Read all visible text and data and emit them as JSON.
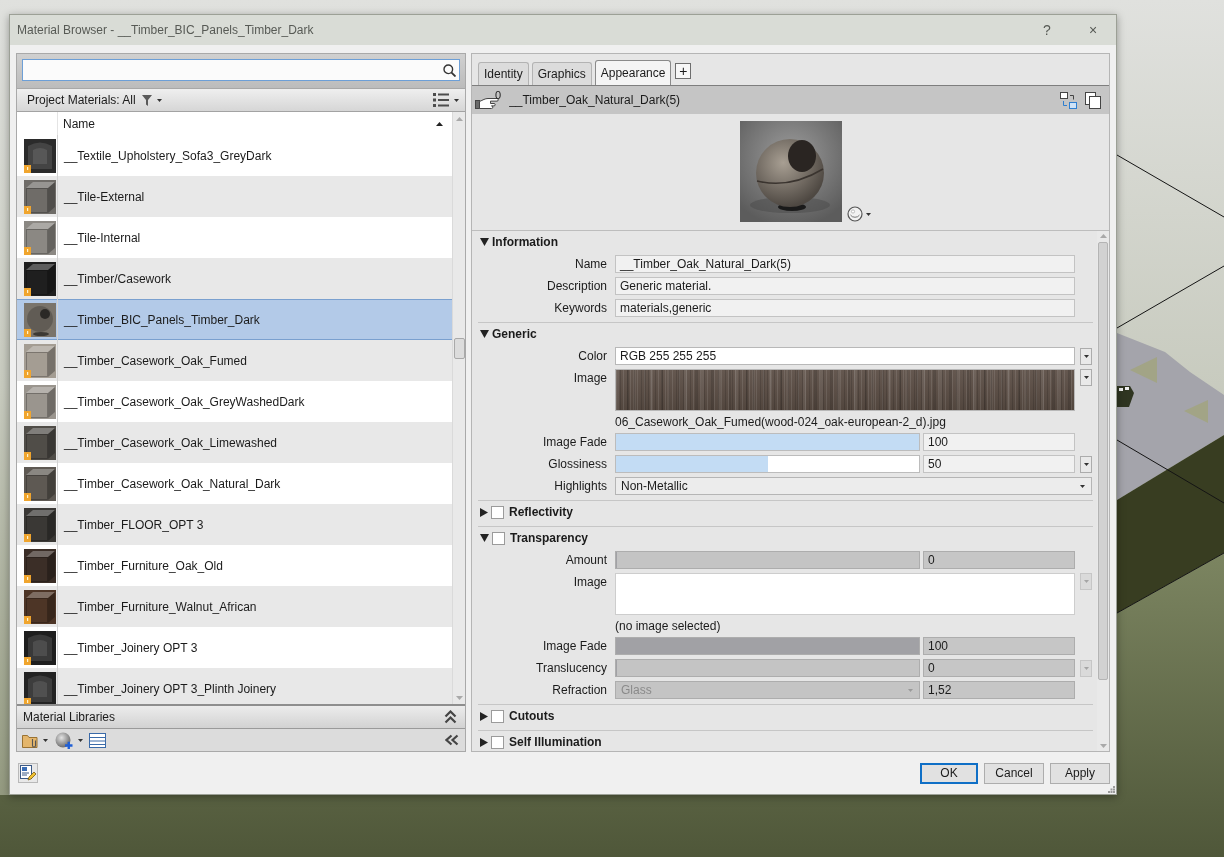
{
  "window": {
    "title": "Material Browser - __Timber_BIC_Panels_Timber_Dark",
    "help": "?",
    "close": "×"
  },
  "browser": {
    "filter_label": "Project Materials: All",
    "columns": [
      "Name"
    ],
    "sorted_ascending": true,
    "rows": [
      {
        "name": "__Textile_Upholstery_Sofa3_GreyDark",
        "kind": "drape",
        "color": "#2b2b2b",
        "selected": false
      },
      {
        "name": "__Tile-External",
        "kind": "cube",
        "color": "#6f6c68",
        "selected": false
      },
      {
        "name": "__Tile-Internal",
        "kind": "cube",
        "color": "#8b8883",
        "selected": false
      },
      {
        "name": "__Timber/Casework",
        "kind": "cube",
        "color": "#1f1f1f",
        "selected": false
      },
      {
        "name": "__Timber_BIC_Panels_Timber_Dark",
        "kind": "sphere",
        "color": "#7a746b",
        "selected": true
      },
      {
        "name": "__Timber_Casework_Oak_Fumed",
        "kind": "cube",
        "color": "#a49d93",
        "selected": false
      },
      {
        "name": "__Timber_Casework_Oak_GreyWashedDark",
        "kind": "cube",
        "color": "#9a958e",
        "selected": false
      },
      {
        "name": "__Timber_Casework_Oak_Limewashed",
        "kind": "cube",
        "color": "#504d48",
        "selected": false
      },
      {
        "name": "__Timber_Casework_Oak_Natural_Dark",
        "kind": "cube",
        "color": "#5e5953",
        "selected": false
      },
      {
        "name": "__Timber_FLOOR_OPT 3",
        "kind": "cube",
        "color": "#3a3835",
        "selected": false
      },
      {
        "name": "__Timber_Furniture_Oak_Old",
        "kind": "cube",
        "color": "#3b2e27",
        "selected": false
      },
      {
        "name": "__Timber_Furniture_Walnut_African",
        "kind": "cube",
        "color": "#4d3526",
        "selected": false
      },
      {
        "name": "__Timber_Joinery OPT 3",
        "kind": "drape",
        "color": "#1e1e1e",
        "selected": false
      },
      {
        "name": "__Timber_Joinery OPT 3_Plinth Joinery",
        "kind": "drape",
        "color": "#232323",
        "selected": false
      }
    ]
  },
  "libraries": {
    "title": "Material Libraries"
  },
  "tabs": [
    {
      "label": "Identity",
      "selected": false
    },
    {
      "label": "Graphics",
      "selected": false
    },
    {
      "label": "Appearance",
      "selected": true
    }
  ],
  "add_tab": "+",
  "asset": {
    "users": "0",
    "name": "__Timber_Oak_Natural_Dark(5)"
  },
  "sections": [
    {
      "title": "Information",
      "kind": "group",
      "expanded": true,
      "fields": [
        {
          "kind": "text",
          "label": "Name",
          "value": "__Timber_Oak_Natural_Dark(5)",
          "disabled": false
        },
        {
          "kind": "text",
          "label": "Description",
          "value": "Generic material.",
          "disabled": false
        },
        {
          "kind": "text",
          "label": "Keywords",
          "value": "materials,generic",
          "disabled": false
        }
      ]
    },
    {
      "title": "Generic",
      "kind": "group",
      "expanded": true,
      "fields": [
        {
          "kind": "color",
          "label": "Color",
          "value": "RGB 255 255 255",
          "menu": true,
          "disabled": false
        },
        {
          "kind": "image",
          "label": "Image",
          "loaded": true,
          "caption": "06_Casework_Oak_Fumed(wood-024_oak-european-2_d).jpg",
          "menu": true,
          "disabled": false
        },
        {
          "kind": "slider",
          "label": "Image Fade",
          "level": 1,
          "value": "100",
          "menu": false,
          "disabled": false
        },
        {
          "kind": "slider",
          "label": "Glossiness",
          "level": 0.5,
          "value": "50",
          "menu": true,
          "disabled": false
        },
        {
          "kind": "select",
          "label": "Highlights",
          "value": "Non-Metallic",
          "disabled": false
        }
      ]
    },
    {
      "title": "Reflectivity",
      "kind": "option",
      "checked": false,
      "expanded": false
    },
    {
      "title": "Transparency",
      "kind": "option",
      "checked": false,
      "expanded": true,
      "fields": [
        {
          "kind": "slider",
          "label": "Amount",
          "level": 0,
          "value": "0",
          "menu": false,
          "disabled": true
        },
        {
          "kind": "image",
          "label": "Image",
          "loaded": false,
          "caption": "(no image selected)",
          "menu": true,
          "disabled": true
        },
        {
          "kind": "slider",
          "label": "Image Fade",
          "level": 1,
          "value": "100",
          "menu": false,
          "disabled": true
        },
        {
          "kind": "slider",
          "label": "Translucency",
          "level": 0,
          "value": "0",
          "menu": true,
          "disabled": true
        },
        {
          "kind": "combo",
          "label": "Refraction",
          "option": "Glass",
          "value": "1,52",
          "disabled": true
        }
      ]
    },
    {
      "title": "Cutouts",
      "kind": "option",
      "checked": false,
      "expanded": false
    },
    {
      "title": "Self Illumination",
      "kind": "option",
      "checked": false,
      "expanded": false
    }
  ],
  "buttons": [
    {
      "label": "OK",
      "default": true
    },
    {
      "label": "Cancel",
      "default": false
    },
    {
      "label": "Apply",
      "default": false
    }
  ]
}
